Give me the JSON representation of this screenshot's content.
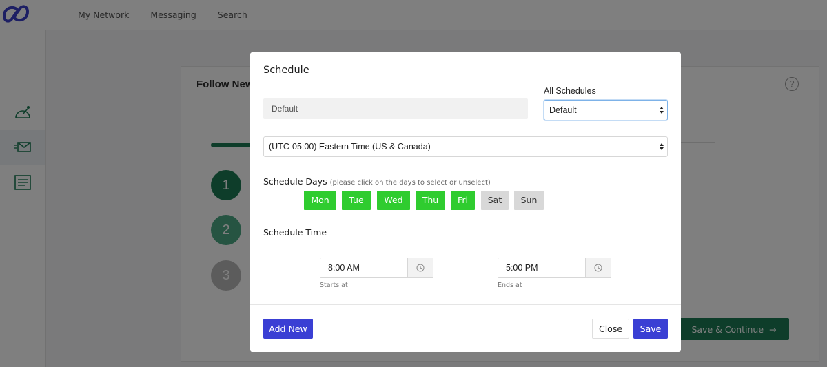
{
  "app": {
    "logo": "logo-mark",
    "nav": [
      "My Network",
      "Messaging",
      "Search"
    ],
    "sidebar_icons": [
      "dashboard-gauge-icon",
      "send-message-icon",
      "document-list-icon"
    ],
    "card_title": "Follow New",
    "steps": [
      "1",
      "2",
      "3"
    ],
    "save_continue_label": "Save & Continue",
    "brand_green": "#1d7a55"
  },
  "modal": {
    "title": "Schedule",
    "all_schedules_label": "All Schedules",
    "schedule_name_value": "Default",
    "all_schedules_selected": "Default",
    "timezone_selected": "(UTC-05:00) Eastern Time (US & Canada)",
    "days_label": "Schedule Days",
    "days_hint": "(please click on the days to select or unselect)",
    "days": [
      {
        "label": "Mon",
        "selected": true
      },
      {
        "label": "Tue",
        "selected": true
      },
      {
        "label": "Wed",
        "selected": true
      },
      {
        "label": "Thu",
        "selected": true
      },
      {
        "label": "Fri",
        "selected": true
      },
      {
        "label": "Sat",
        "selected": false
      },
      {
        "label": "Sun",
        "selected": false
      }
    ],
    "time_label": "Schedule Time",
    "start_time": "8:00 AM",
    "start_caption": "Starts at",
    "end_time": "5:00 PM",
    "end_caption": "Ends at",
    "add_new_label": "Add New",
    "close_label": "Close",
    "save_label": "Save",
    "colors": {
      "day_selected": "#2fcc2f",
      "day_unselected": "#d8d8d8",
      "primary": "#3a3fd4"
    }
  }
}
